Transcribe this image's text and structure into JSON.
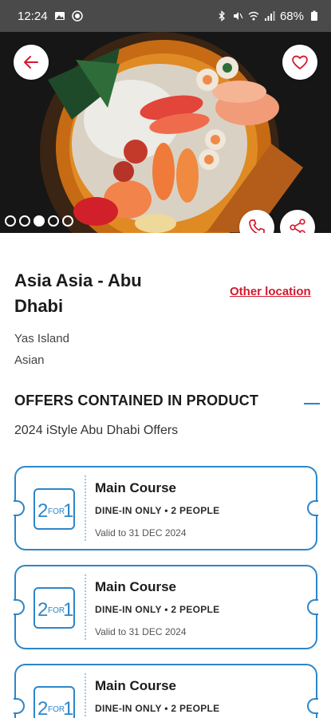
{
  "status_bar": {
    "time": "12:24",
    "battery": "68%"
  },
  "hero": {
    "dots": [
      {
        "active": false
      },
      {
        "active": false
      },
      {
        "active": true
      },
      {
        "active": false
      },
      {
        "active": false
      }
    ],
    "icons": {
      "back": "arrow-left-icon",
      "favorite": "heart-icon",
      "call": "phone-icon",
      "share": "share-icon"
    }
  },
  "restaurant": {
    "name": "Asia Asia - Abu Dhabi",
    "other_location": "Other location",
    "area": "Yas Island",
    "cuisine": "Asian"
  },
  "offers_section": {
    "heading": "OFFERS CONTAINED IN PRODUCT",
    "subheading": "2024 iStyle Abu Dhabi Offers"
  },
  "offers": [
    {
      "badge": "2 FOR 1",
      "title": "Main Course",
      "tags": "DINE-IN ONLY • 2 PEOPLE",
      "valid": "Valid to 31 DEC 2024"
    },
    {
      "badge": "2 FOR 1",
      "title": "Main Course",
      "tags": "DINE-IN ONLY • 2 PEOPLE",
      "valid": "Valid to 31 DEC 2024"
    },
    {
      "badge": "2 FOR 1",
      "title": "Main Course",
      "tags": "DINE-IN ONLY • 2 PEOPLE",
      "valid": ""
    }
  ],
  "colors": {
    "accent_red": "#d3192e",
    "accent_blue": "#2e86c8",
    "status_bar": "#4a4a4a"
  }
}
